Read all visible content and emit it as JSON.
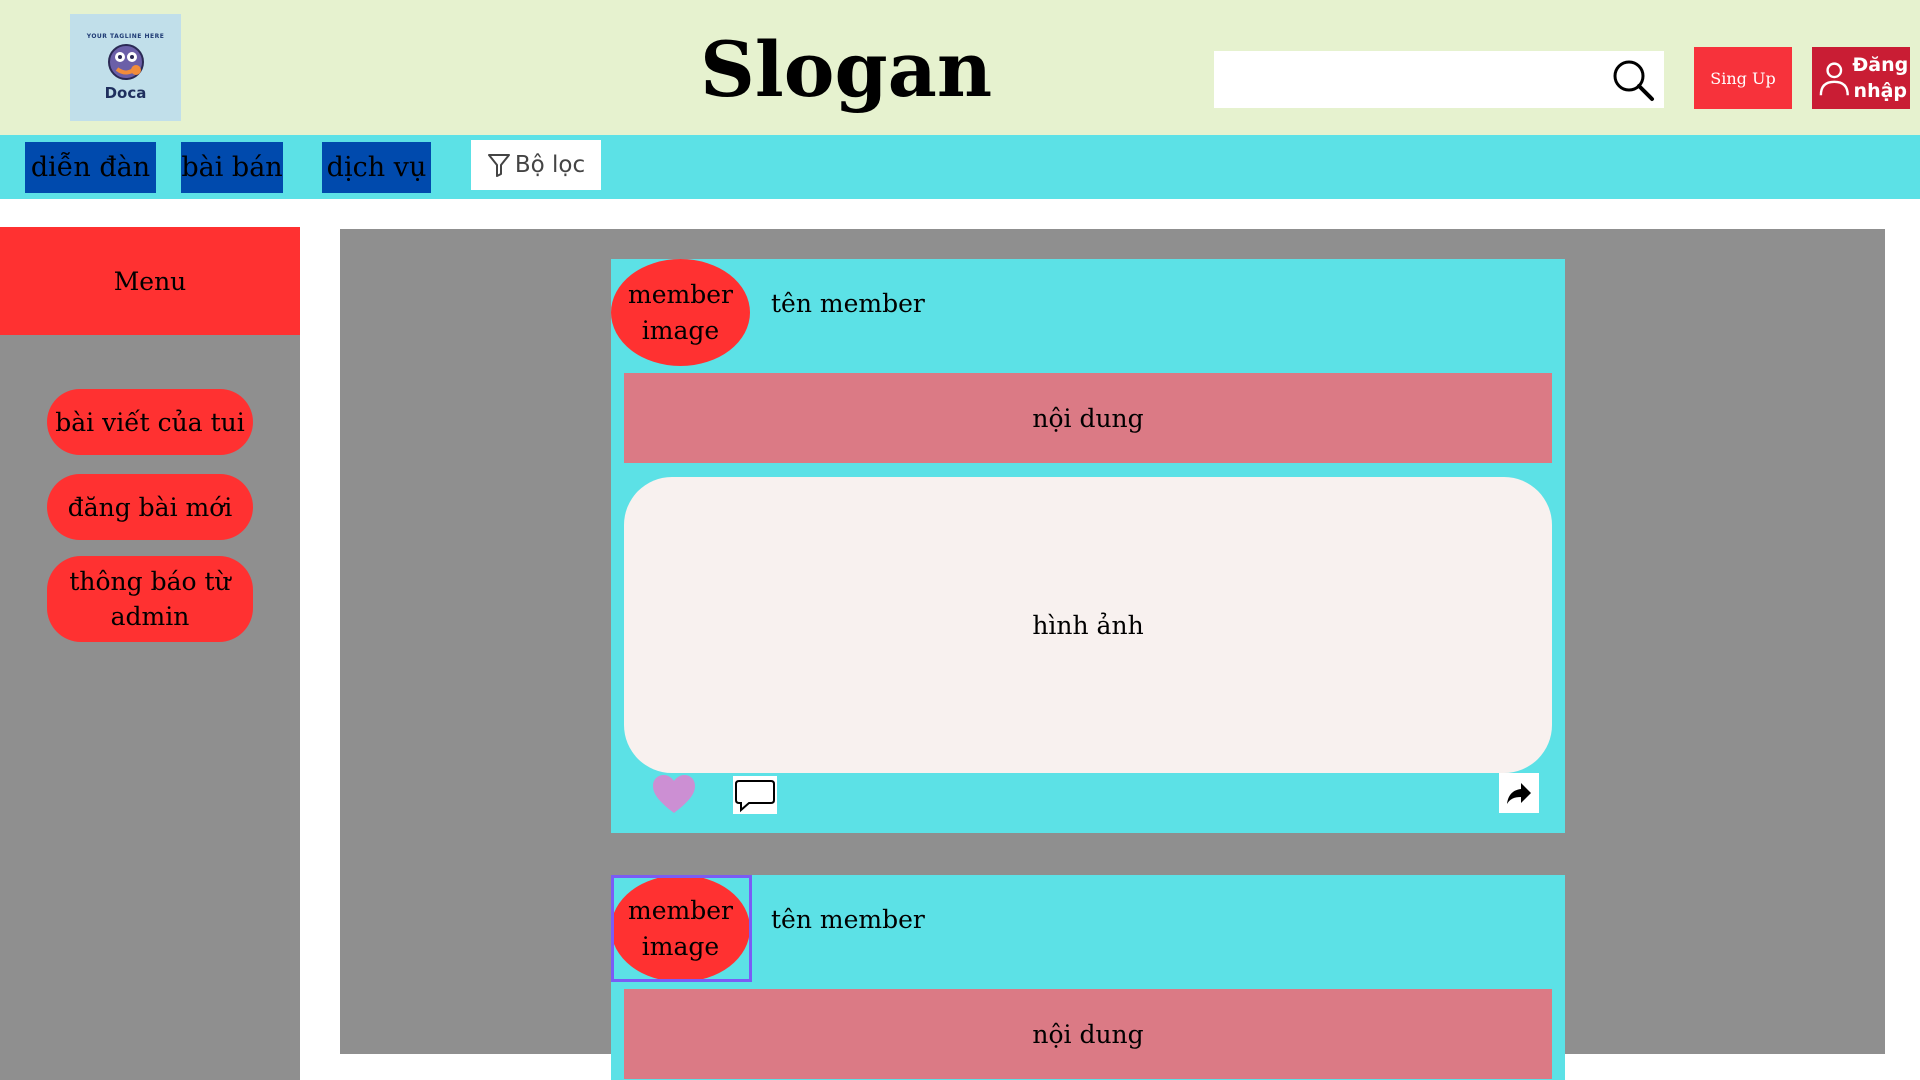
{
  "header": {
    "logo_tagline": "YOUR TAGLINE HERE",
    "logo_name": "Doca",
    "slogan": "Slogan",
    "search_placeholder": "",
    "signup_label": "Sing Up",
    "login_label": "Đăng\nnhập"
  },
  "nav": {
    "items": [
      {
        "label": "diễn đàn"
      },
      {
        "label": "bài bán"
      },
      {
        "label": "dịch vụ"
      }
    ],
    "filter_label": "Bộ lọc"
  },
  "sidebar": {
    "title": "Menu",
    "items": [
      {
        "label": "bài viết của tui"
      },
      {
        "label": "đăng bài mới"
      },
      {
        "label": "thông báo từ admin"
      }
    ]
  },
  "posts": [
    {
      "avatar_label": "member\nimage",
      "member_name": "tên member",
      "content": "nội dung",
      "image_label": "hình ảnh"
    },
    {
      "avatar_label": "member\nimage",
      "member_name": "tên member",
      "content": "nội dung"
    }
  ],
  "colors": {
    "header_bg": "#e6f2cf",
    "nav_bg": "#5ce1e6",
    "nav_button": "#004aad",
    "accent_red": "#ff3131",
    "panel_gray": "#8f8f8f",
    "content_pink": "#db7a85",
    "heart": "#cc8fd3"
  }
}
